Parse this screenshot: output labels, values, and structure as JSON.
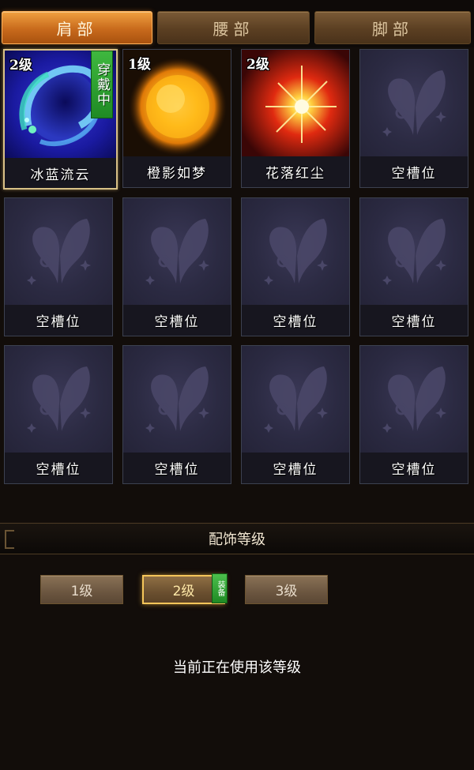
{
  "tabs": [
    {
      "label": "肩部",
      "active": true
    },
    {
      "label": "腰部",
      "active": false
    },
    {
      "label": "脚部",
      "active": false
    }
  ],
  "slots": [
    {
      "name": "冰蓝流云",
      "level": "2级",
      "badge": "穿戴中",
      "icon": "blue-swirl-orb-icon",
      "selected": true
    },
    {
      "name": "橙影如梦",
      "level": "1级",
      "badge": "",
      "icon": "golden-sun-icon",
      "selected": false
    },
    {
      "name": "花落红尘",
      "level": "2级",
      "badge": "",
      "icon": "red-starburst-icon",
      "selected": false
    },
    {
      "name": "空槽位",
      "level": "",
      "badge": "",
      "icon": "butterfly-placeholder-icon",
      "selected": false
    },
    {
      "name": "空槽位",
      "level": "",
      "badge": "",
      "icon": "butterfly-placeholder-icon",
      "selected": false
    },
    {
      "name": "空槽位",
      "level": "",
      "badge": "",
      "icon": "butterfly-placeholder-icon",
      "selected": false
    },
    {
      "name": "空槽位",
      "level": "",
      "badge": "",
      "icon": "butterfly-placeholder-icon",
      "selected": false
    },
    {
      "name": "空槽位",
      "level": "",
      "badge": "",
      "icon": "butterfly-placeholder-icon",
      "selected": false
    },
    {
      "name": "空槽位",
      "level": "",
      "badge": "",
      "icon": "butterfly-placeholder-icon",
      "selected": false
    },
    {
      "name": "空槽位",
      "level": "",
      "badge": "",
      "icon": "butterfly-placeholder-icon",
      "selected": false
    },
    {
      "name": "空槽位",
      "level": "",
      "badge": "",
      "icon": "butterfly-placeholder-icon",
      "selected": false
    },
    {
      "name": "空槽位",
      "level": "",
      "badge": "",
      "icon": "butterfly-placeholder-icon",
      "selected": false
    }
  ],
  "level_section": {
    "title": "配饰等级",
    "buttons": [
      {
        "label": "1级",
        "active": false
      },
      {
        "label": "2级",
        "active": true
      },
      {
        "label": "3级",
        "active": false
      }
    ],
    "equip_badge": "装备",
    "status": "当前正在使用该等级"
  },
  "colors": {
    "tab_active": "#c86a1c",
    "badge_green": "#2a9a2e",
    "selected_border": "#d9c187"
  }
}
